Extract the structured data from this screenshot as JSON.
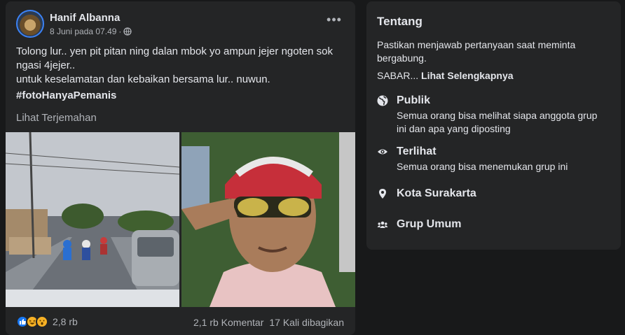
{
  "post": {
    "author": "Hanif Albanna",
    "time": "8 Juni pada 07.49",
    "separator": "·",
    "more_label": "•••",
    "lines": [
      "Tolong lur.. yen pit pitan ning dalan mbok yo ampun jejer ngoten sok",
      "ngasi 4jejer..",
      "untuk keselamatan dan kebaikan bersama lur.. nuwun."
    ],
    "hashtag": "#fotoHanyaPemanis",
    "translate_label": "Lihat Terjemahan",
    "reaction_count": "2,8 rb",
    "comments": "2,1 rb Komentar",
    "shares": "17 Kali dibagikan"
  },
  "about": {
    "title": "Tentang",
    "description": "Pastikan menjawab pertanyaan saat meminta bergabung.",
    "sabar_prefix": "SABAR... ",
    "see_more": "Lihat Selengkapnya",
    "items": [
      {
        "icon": "globe-icon",
        "title": "Publik",
        "desc": "Semua orang bisa melihat siapa anggota grup ini dan apa yang diposting"
      },
      {
        "icon": "eye-icon",
        "title": "Terlihat",
        "desc": "Semua orang bisa menemukan grup ini"
      },
      {
        "icon": "location-pin-icon",
        "title": "Kota Surakarta",
        "desc": ""
      },
      {
        "icon": "group-icon",
        "title": "Grup Umum",
        "desc": ""
      }
    ]
  },
  "colors": {
    "background": "#18191a",
    "card": "#242526",
    "text_primary": "#e4e6eb",
    "text_secondary": "#b0b3b8",
    "like_blue": "#1877f2"
  }
}
